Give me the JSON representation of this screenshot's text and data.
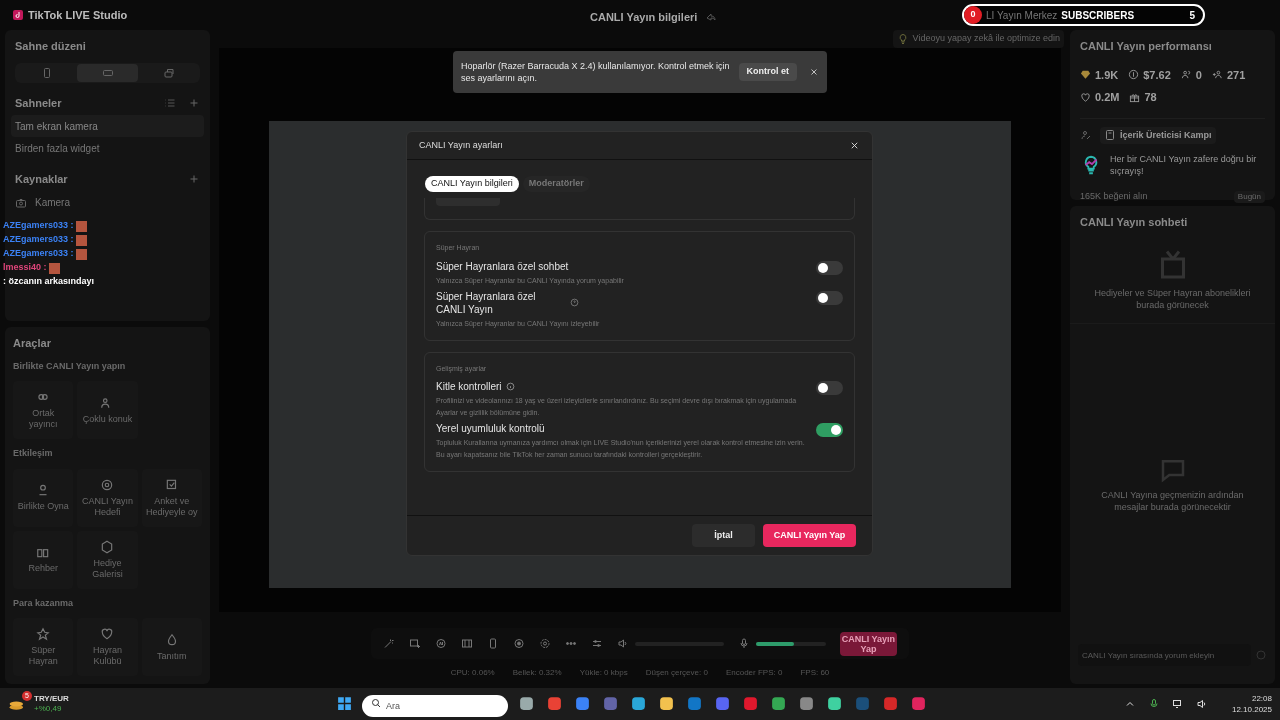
{
  "app": {
    "title": "TikTok LIVE Studio",
    "header_title": "CANLI Yayın bilgileri"
  },
  "stream_widget": {
    "badge": "0",
    "label": "LI Yayın Merkez",
    "subscribers_label": "SUBSCRIBERS",
    "subscribers_count": "5"
  },
  "ai_hint": "Videoyu yapay zekâ ile optimize edin",
  "toast": {
    "message": "Hoparlör (Razer Barracuda X 2.4) kullanılamıyor. Kontrol etmek için ses ayarlarını açın.",
    "action": "Kontrol et"
  },
  "left": {
    "layout_title": "Sahne düzeni",
    "layouts": [
      {
        "kind": "portrait",
        "selected": false
      },
      {
        "kind": "landscape",
        "selected": true
      },
      {
        "kind": "other",
        "selected": false
      }
    ],
    "scenes_title": "Sahneler",
    "scenes": [
      {
        "label": "Tam ekran kamera",
        "selected": true
      },
      {
        "label": "Birden fazla widget",
        "selected": false
      }
    ],
    "sources_title": "Kaynaklar",
    "sources": [
      {
        "label": "Kamera"
      }
    ],
    "tools_title": "Araçlar",
    "tool_groups": [
      {
        "title": "Birlikte CANLI Yayın yapın",
        "items": [
          {
            "label": "Ortak yayıncı"
          },
          {
            "label": "Çoklu konuk"
          }
        ]
      },
      {
        "title": "Etkileşim",
        "items": [
          {
            "label": "Birlikte Oyna"
          },
          {
            "label": "CANLI Yayın Hedefi"
          },
          {
            "label": "Anket ve Hediyeyle oy"
          },
          {
            "label": "Rehber"
          },
          {
            "label": "Hediye Galerisi"
          }
        ]
      },
      {
        "title": "Para kazanma",
        "items": [
          {
            "label": "Süper Hayran"
          },
          {
            "label": "Hayran Kulübü"
          },
          {
            "label": "Tanıtım"
          }
        ]
      }
    ]
  },
  "chat_overlay": [
    {
      "user": "AZEgamers033 :",
      "color": "#3b82f6"
    },
    {
      "user": "AZEgamers033 :",
      "color": "#3b82f6"
    },
    {
      "user": "AZEgamers033 :",
      "color": "#3b82f6"
    },
    {
      "user": "lmessi40 :",
      "color": "#e0457b"
    },
    {
      "message": ": özcanın arkasındayı"
    }
  ],
  "toolbar": {
    "speaker": {
      "level": 0
    },
    "mic": {
      "level": 0.55
    },
    "go_live": "CANLI Yayın Yap"
  },
  "stats": [
    "CPU: 0.06%",
    "Bellek: 0.32%",
    "Yükle: 0 kbps",
    "Düşen çerçeve: 0",
    "Encoder FPS: 0",
    "FPS: 60"
  ],
  "right": {
    "performance_title": "CANLI Yayın performansı",
    "metrics": [
      {
        "kind": "diamond",
        "value": "1.9K"
      },
      {
        "kind": "coin",
        "value": "$7.62"
      },
      {
        "kind": "viewers",
        "value": "0"
      },
      {
        "kind": "followers",
        "value": "271"
      },
      {
        "kind": "likes",
        "value": "0.2M"
      },
      {
        "kind": "gifts",
        "value": "78"
      }
    ],
    "camp_label": "İçerik Üreticisi Kampı",
    "camp_text": "Her bir CANLI Yayın zafere doğru bir sıçrayış!",
    "goal": "165K beğeni alın",
    "goal_when": "Bugün",
    "chat_title": "CANLI Yayın sohbeti",
    "gifts_empty": "Hediyeler ve Süper Hayran abonelikleri burada görünecek",
    "chat_empty": "CANLI Yayına geçmenizin ardından mesajlar burada görünecektir",
    "chat_placeholder": "CANLI Yayın sırasında yorum ekleyin"
  },
  "dialog": {
    "title": "CANLI Yayın ayarları",
    "tabs": [
      {
        "label": "CANLI Yayın bilgileri",
        "selected": true
      },
      {
        "label": "Moderatörler",
        "selected": false
      }
    ],
    "sections": [
      {
        "title": "Süper Hayran",
        "settings": [
          {
            "label": "Süper Hayranlara özel sohbet",
            "help": false,
            "info": false,
            "on": false,
            "description": "Yalnızca Süper Hayranlar bu CANLI Yayında yorum yapabilir"
          },
          {
            "label": "Süper Hayranlara özel CANLI Yayın",
            "help": true,
            "info": false,
            "on": false,
            "description": "Yalnızca Süper Hayranlar bu CANLI Yayını izleyebilir"
          }
        ]
      },
      {
        "title": "Gelişmiş ayarlar",
        "settings": [
          {
            "label": "Kitle kontrolleri",
            "help": false,
            "info": true,
            "on": false,
            "description": "Profilinizi ve videolarınızı 18 yaş ve üzeri izleyicilerle sınırlandırdınız. Bu seçimi devre dışı bırakmak için uygulamada Ayarlar ve gizlilik bölümüne gidin."
          },
          {
            "label": "Yerel uyumluluk kontrolü",
            "help": false,
            "info": false,
            "on": true,
            "description": "Topluluk Kurallarına uymanıza yardımcı olmak için LIVE Studio'nun içeriklerinizi yerel olarak kontrol etmesine izin verin. Bu ayarı kapatsanız bile TikTok her zaman sunucu tarafındaki kontrolleri gerçekleştirir."
          }
        ]
      }
    ],
    "cancel": "İptal",
    "confirm": "CANLI Yayın Yap"
  },
  "taskbar": {
    "ticker_badge": "5",
    "ticker_pair": "TRY/EUR",
    "ticker_change": "+%0,49",
    "search_placeholder": "Ara",
    "time": "22:08",
    "date": "12.10.2025"
  }
}
